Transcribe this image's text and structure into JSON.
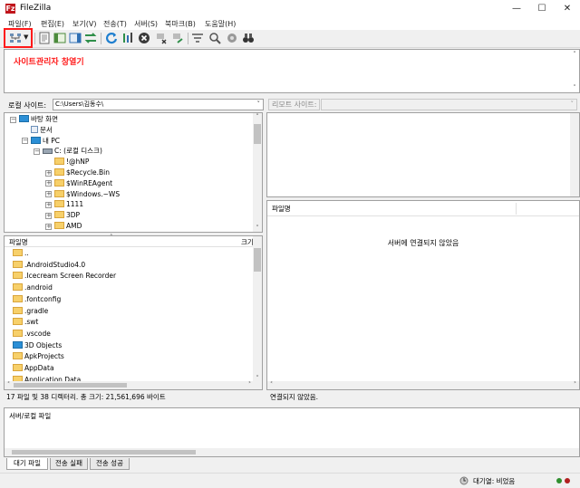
{
  "window": {
    "title": "FileZilla",
    "minimize": "—",
    "maximize": "☐",
    "close": "✕"
  },
  "menu": [
    "파일(F)",
    "편집(E)",
    "보기(V)",
    "전송(T)",
    "서버(S)",
    "북마크(B)",
    "도움말(H)"
  ],
  "toolbar": {
    "icons": [
      "site-manager-icon",
      "dropdown-arrow-icon",
      "message-log-icon",
      "local-tree-icon",
      "remote-tree-icon",
      "transfer-queue-icon",
      "refresh-icon",
      "process-queue-icon",
      "cancel-icon",
      "disconnect-icon",
      "reconnect-icon",
      "filter-icon",
      "search-icon",
      "compare-icon",
      "binoculars-icon"
    ]
  },
  "message_log": {
    "text": "사이트관리자 창열기"
  },
  "local": {
    "label": "로컬 사이트:",
    "path": "C:\\Users\\김동수\\",
    "tree": [
      {
        "label": "바탕 화면",
        "indent": 0,
        "expander": "−",
        "icon": "desktop"
      },
      {
        "label": "문서",
        "indent": 1,
        "expander": "",
        "icon": "doc"
      },
      {
        "label": "내 PC",
        "indent": 1,
        "expander": "−",
        "icon": "pc"
      },
      {
        "label": "C: (로컬 디스크)",
        "indent": 2,
        "expander": "−",
        "icon": "drive"
      },
      {
        "label": "!@hNP",
        "indent": 3,
        "expander": "",
        "icon": "folder"
      },
      {
        "label": "$Recycle.Bin",
        "indent": 3,
        "expander": "+",
        "icon": "folder"
      },
      {
        "label": "$WinREAgent",
        "indent": 3,
        "expander": "+",
        "icon": "folder"
      },
      {
        "label": "$Windows.~WS",
        "indent": 3,
        "expander": "+",
        "icon": "folder"
      },
      {
        "label": "1111",
        "indent": 3,
        "expander": "+",
        "icon": "folder"
      },
      {
        "label": "3DP",
        "indent": 3,
        "expander": "+",
        "icon": "folder"
      },
      {
        "label": "AMD",
        "indent": 3,
        "expander": "+",
        "icon": "folder"
      }
    ],
    "list_header": {
      "name": "파일명",
      "size": "크기"
    },
    "files": [
      {
        "name": "..",
        "blue": false
      },
      {
        "name": ".AndroidStudio4.0",
        "blue": false
      },
      {
        "name": ".Icecream Screen Recorder",
        "blue": false
      },
      {
        "name": ".android",
        "blue": false
      },
      {
        "name": ".fontconfig",
        "blue": false
      },
      {
        "name": ".gradle",
        "blue": false
      },
      {
        "name": ".swt",
        "blue": false
      },
      {
        "name": ".vscode",
        "blue": false
      },
      {
        "name": "3D Objects",
        "blue": true
      },
      {
        "name": "ApkProjects",
        "blue": false
      },
      {
        "name": "AppData",
        "blue": false
      },
      {
        "name": "Application Data",
        "blue": false
      }
    ],
    "status": "17 파일 및 38 디렉터리. 총 크기: 21,561,696 바이트"
  },
  "remote": {
    "label": "리모트 사이트:",
    "path": "",
    "list_header": {
      "name": "파일명"
    },
    "empty_msg": "서버에 연결되지 않았음",
    "status": "연결되지 않았음."
  },
  "queue": {
    "header": "서버/로컬 파일",
    "tabs": [
      "대기 파일",
      "전송 실패",
      "전송 성공"
    ]
  },
  "statusbar": {
    "queue_label": "대기열: 비었음"
  },
  "colors": {
    "highlight": "#ff1a1a",
    "folder": "#f7d06a",
    "blue_folder": "#2b8fd6"
  }
}
